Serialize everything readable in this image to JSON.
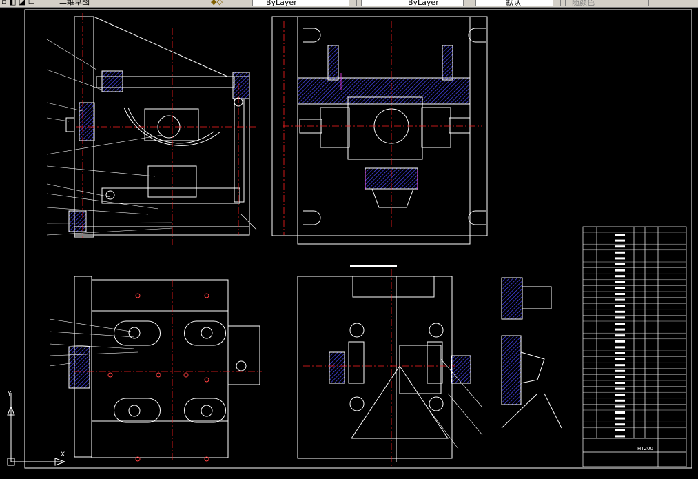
{
  "toolbar": {
    "workspace_label": "二维草图",
    "layer_color_combo": "ByLayer",
    "linetype_combo": "ByLayer",
    "lineweight_combo": "默认",
    "plotstyle_combo": "随颜色"
  },
  "drawing": {
    "title_block_material": "HT200",
    "colors": {
      "background": "#000000",
      "outline": "#ffffff",
      "centerline": "#ff2020",
      "hatch": "#4040ff",
      "hidden": "#ff40ff",
      "dimension": "#ffffff"
    }
  }
}
